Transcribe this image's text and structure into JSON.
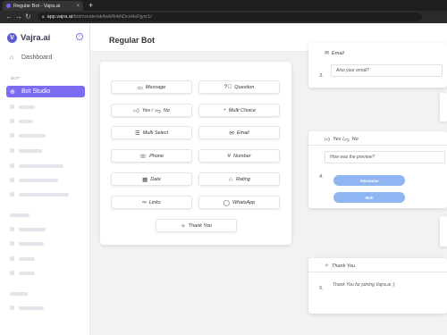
{
  "browser": {
    "tab_title": "Regular Bot - Vajra.ai",
    "tab_close": "×",
    "new_tab": "+",
    "back": "←",
    "forward": "→",
    "reload": "↻",
    "url_host": "app.vajra.ai",
    "url_path": "/bot/create/ak4wkRnkhDcxHxFjyxr1/"
  },
  "sidebar": {
    "brand": "Vajra.ai",
    "brand_logo": "V",
    "collapse_icon": "chevron-left-icon",
    "dashboard": "Dashboard",
    "section_bot": "BOT",
    "active_item": "Bot Studio"
  },
  "header": {
    "title": "Regular Bot"
  },
  "palette": {
    "message": "Message",
    "question": "Question",
    "yes_no": "Yes / ",
    "no": "No",
    "multi_choice": "Multi Choice",
    "multi_select": "Multi Select",
    "email": "Email",
    "phone": "Phone",
    "number": "Number",
    "date": "Date",
    "rating": "Rating",
    "links": "Links",
    "whatsapp": "WhatsApp",
    "thank_you": "Thank You"
  },
  "canvas": {
    "email_card": {
      "head": "Email",
      "num": "3.",
      "question": "Also your email?"
    },
    "yesno_card": {
      "head_yes": "Yes / ",
      "head_no": "No",
      "num": "4.",
      "question": "How was the preview?",
      "choice_yes": "Awesome",
      "choice_no": "Meh"
    },
    "thanks_card": {
      "head": "Thank You",
      "num": "5.",
      "question": "Thank You for joining Vajra.ai :)"
    }
  },
  "colors": {
    "accent": "#7c6cf0",
    "brand": "#5b5bd6",
    "choice": "#8fb6f2"
  }
}
